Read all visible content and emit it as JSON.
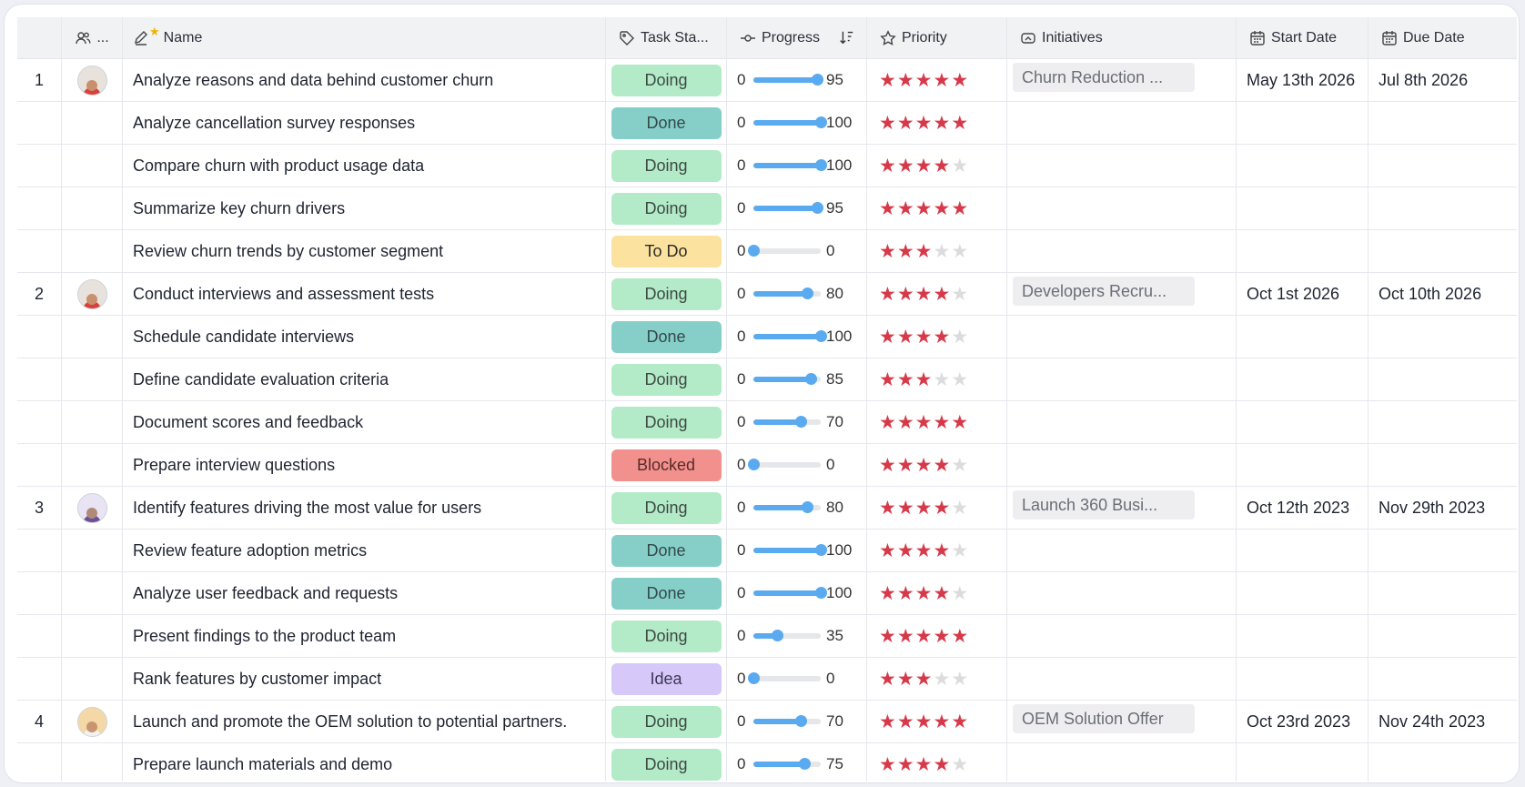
{
  "header": {
    "assignee": "...",
    "name": "Name",
    "task_status": "Task Sta...",
    "progress": "Progress",
    "priority": "Priority",
    "initiatives": "Initiatives",
    "start_date": "Start Date",
    "due_date": "Due Date"
  },
  "colors": {
    "doing": "#b3ebc8",
    "done": "#86cfc9",
    "todo": "#fbe29f",
    "blocked": "#f1908c",
    "idea": "#d6c8f8",
    "progress": "#5aaaf0",
    "star_on": "#d63a4a",
    "star_off": "#dcdcdc"
  },
  "rows": [
    {
      "num": "1",
      "avatar": "avatar-red",
      "name": "Analyze reasons and data behind customer churn",
      "status": "Doing",
      "min": "0",
      "value": 95,
      "priority": 5,
      "initiative": "Churn Reduction ...",
      "start": "May 13th 2026",
      "due": "Jul 8th 2026"
    },
    {
      "num": "",
      "avatar": "",
      "name": "Analyze cancellation survey responses",
      "status": "Done",
      "min": "0",
      "value": 100,
      "priority": 5,
      "initiative": "",
      "start": "",
      "due": ""
    },
    {
      "num": "",
      "avatar": "",
      "name": "Compare churn with product usage data",
      "status": "Doing",
      "min": "0",
      "value": 100,
      "priority": 4,
      "initiative": "",
      "start": "",
      "due": ""
    },
    {
      "num": "",
      "avatar": "",
      "name": "Summarize key churn drivers",
      "status": "Doing",
      "min": "0",
      "value": 95,
      "priority": 5,
      "initiative": "",
      "start": "",
      "due": ""
    },
    {
      "num": "",
      "avatar": "",
      "name": "Review churn trends by customer segment",
      "status": "To Do",
      "min": "0",
      "value": 0,
      "priority": 3,
      "initiative": "",
      "start": "",
      "due": ""
    },
    {
      "num": "2",
      "avatar": "avatar-red",
      "name": "Conduct interviews and assessment tests",
      "status": "Doing",
      "min": "0",
      "value": 80,
      "priority": 4,
      "initiative": "Developers Recru...",
      "start": "Oct 1st 2026",
      "due": "Oct 10th 2026"
    },
    {
      "num": "",
      "avatar": "",
      "name": "Schedule candidate interviews",
      "status": "Done",
      "min": "0",
      "value": 100,
      "priority": 4,
      "initiative": "",
      "start": "",
      "due": ""
    },
    {
      "num": "",
      "avatar": "",
      "name": "Define candidate evaluation criteria",
      "status": "Doing",
      "min": "0",
      "value": 85,
      "priority": 3,
      "initiative": "",
      "start": "",
      "due": ""
    },
    {
      "num": "",
      "avatar": "",
      "name": "Document scores and feedback",
      "status": "Doing",
      "min": "0",
      "value": 70,
      "priority": 5,
      "initiative": "",
      "start": "",
      "due": ""
    },
    {
      "num": "",
      "avatar": "",
      "name": "Prepare interview questions",
      "status": "Blocked",
      "min": "0",
      "value": 0,
      "priority": 4,
      "initiative": "",
      "start": "",
      "due": ""
    },
    {
      "num": "3",
      "avatar": "avatar-purple",
      "name": "Identify features driving the most value for users",
      "status": "Doing",
      "min": "0",
      "value": 80,
      "priority": 4,
      "initiative": "Launch 360 Busi...",
      "start": "Oct 12th 2023",
      "due": "Nov 29th 2023"
    },
    {
      "num": "",
      "avatar": "",
      "name": "Review feature adoption metrics",
      "status": "Done",
      "min": "0",
      "value": 100,
      "priority": 4,
      "initiative": "",
      "start": "",
      "due": ""
    },
    {
      "num": "",
      "avatar": "",
      "name": "Analyze user feedback and requests",
      "status": "Done",
      "min": "0",
      "value": 100,
      "priority": 4,
      "initiative": "",
      "start": "",
      "due": ""
    },
    {
      "num": "",
      "avatar": "",
      "name": "Present findings to the product team",
      "status": "Doing",
      "min": "0",
      "value": 35,
      "priority": 5,
      "initiative": "",
      "start": "",
      "due": ""
    },
    {
      "num": "",
      "avatar": "",
      "name": "Rank features by customer impact",
      "status": "Idea",
      "min": "0",
      "value": 0,
      "priority": 3,
      "initiative": "",
      "start": "",
      "due": ""
    },
    {
      "num": "4",
      "avatar": "avatar-orange",
      "name": "Launch and promote the OEM solution to potential partners.",
      "status": "Doing",
      "min": "0",
      "value": 70,
      "priority": 5,
      "initiative": "OEM Solution Offer",
      "start": "Oct 23rd 2023",
      "due": "Nov 24th 2023"
    },
    {
      "num": "",
      "avatar": "",
      "name": "Prepare launch materials and demo",
      "status": "Doing",
      "min": "0",
      "value": 75,
      "priority": 4,
      "initiative": "",
      "start": "",
      "due": ""
    }
  ]
}
